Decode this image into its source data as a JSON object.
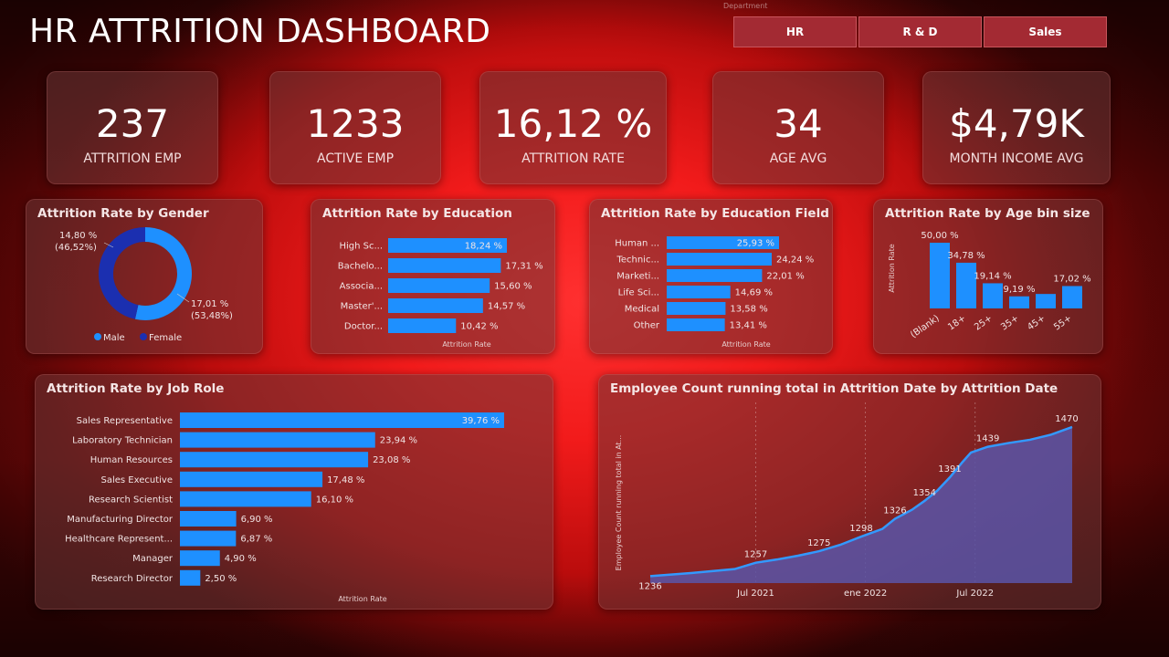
{
  "page": {
    "title": "HR ATTRITION DASHBOARD"
  },
  "slicer": {
    "label": "Department",
    "options": [
      "HR",
      "R & D",
      "Sales"
    ]
  },
  "colors": {
    "bar": "#1e90ff",
    "female": "#1b2fb0",
    "area_fill": "#5a55a8",
    "area_line": "#3399ff"
  },
  "kpis": [
    {
      "value": "237",
      "label": "ATTRITION EMP"
    },
    {
      "value": "1233",
      "label": "ACTIVE EMP"
    },
    {
      "value": "16,12 %",
      "label": "ATTRITION RATE"
    },
    {
      "value": "34",
      "label": "AGE AVG"
    },
    {
      "value": "$4,79K",
      "label": "MONTH INCOME AVG"
    }
  ],
  "chart_data": [
    {
      "id": "gender",
      "type": "pie",
      "title": "Attrition Rate by Gender",
      "categories": [
        "Male",
        "Female"
      ],
      "values": [
        17.01,
        14.8
      ],
      "shares": [
        53.48,
        46.52
      ],
      "data_labels": [
        "17,01 %",
        "14,80 %"
      ],
      "share_labels": [
        "(53,48%)",
        "(46,52%)"
      ],
      "legend": "bottom"
    },
    {
      "id": "education",
      "type": "bar",
      "orientation": "horizontal",
      "title": "Attrition Rate by Education",
      "categories": [
        "High Sc...",
        "Bachelo...",
        "Associa...",
        "Master'...",
        "Doctor..."
      ],
      "values": [
        18.24,
        17.31,
        15.6,
        14.57,
        10.42
      ],
      "data_labels": [
        "18,24 %",
        "17,31 %",
        "15,60 %",
        "14,57 %",
        "10,42 %"
      ],
      "xlabel": "Attrition Rate"
    },
    {
      "id": "education_field",
      "type": "bar",
      "orientation": "horizontal",
      "title": "Attrition Rate by Education Field",
      "categories": [
        "Human ...",
        "Technic...",
        "Marketi...",
        "Life Sci...",
        "Medical",
        "Other"
      ],
      "values": [
        25.93,
        24.24,
        22.01,
        14.69,
        13.58,
        13.41
      ],
      "data_labels": [
        "25,93 %",
        "24,24 %",
        "22,01 %",
        "14,69 %",
        "13,58 %",
        "13,41 %"
      ],
      "xlabel": "Attrition Rate"
    },
    {
      "id": "age_bin",
      "type": "bar",
      "orientation": "vertical",
      "title": "Attrition Rate by Age bin size",
      "categories": [
        "(Blank)",
        "18+",
        "25+",
        "35+",
        "45+",
        "55+"
      ],
      "values": [
        50.0,
        34.78,
        19.14,
        9.19,
        11.0,
        17.02
      ],
      "data_labels": [
        "50,00 %",
        "34,78 %",
        "19,14 %",
        "9,19 %",
        "",
        "17,02 %"
      ],
      "ylabel": "Attrition Rate"
    },
    {
      "id": "job_role",
      "type": "bar",
      "orientation": "horizontal",
      "title": "Attrition Rate by Job Role",
      "categories": [
        "Sales Representative",
        "Laboratory Technician",
        "Human Resources",
        "Sales Executive",
        "Research Scientist",
        "Manufacturing Director",
        "Healthcare Represent...",
        "Manager",
        "Research Director"
      ],
      "values": [
        39.76,
        23.94,
        23.08,
        17.48,
        16.1,
        6.9,
        6.87,
        4.9,
        2.5
      ],
      "data_labels": [
        "39,76 %",
        "23,94 %",
        "23,08 %",
        "17,48 %",
        "16,10 %",
        "6,90 %",
        "6,87 %",
        "4,90 %",
        "2,50 %"
      ],
      "xlabel": "Attrition Rate"
    },
    {
      "id": "running_total",
      "type": "area",
      "title": "Employee Count running total in Attrition Date by Attrition Date",
      "ylabel": "Employee Count running total in At...",
      "x_ticks": [
        "Jul 2021",
        "ene 2022",
        "Jul 2022"
      ],
      "x_tick_pos": [
        0.25,
        0.51,
        0.77
      ],
      "points": [
        [
          0,
          1236
        ],
        [
          0.1,
          1241
        ],
        [
          0.2,
          1247
        ],
        [
          0.25,
          1257
        ],
        [
          0.3,
          1262
        ],
        [
          0.35,
          1268
        ],
        [
          0.4,
          1275
        ],
        [
          0.45,
          1285
        ],
        [
          0.5,
          1298
        ],
        [
          0.55,
          1310
        ],
        [
          0.58,
          1326
        ],
        [
          0.62,
          1340
        ],
        [
          0.65,
          1354
        ],
        [
          0.68,
          1370
        ],
        [
          0.71,
          1391
        ],
        [
          0.74,
          1415
        ],
        [
          0.76,
          1430
        ],
        [
          0.8,
          1439
        ],
        [
          0.85,
          1445
        ],
        [
          0.9,
          1450
        ],
        [
          0.95,
          1458
        ],
        [
          1.0,
          1470
        ]
      ],
      "labels": [
        {
          "x": 0,
          "y": 1236,
          "text": "1236"
        },
        {
          "x": 0.25,
          "y": 1257,
          "text": "1257"
        },
        {
          "x": 0.4,
          "y": 1275,
          "text": "1275"
        },
        {
          "x": 0.5,
          "y": 1298,
          "text": "1298"
        },
        {
          "x": 0.58,
          "y": 1326,
          "text": "1326"
        },
        {
          "x": 0.65,
          "y": 1354,
          "text": "1354"
        },
        {
          "x": 0.71,
          "y": 1391,
          "text": "1391"
        },
        {
          "x": 0.8,
          "y": 1439,
          "text": "1439"
        },
        {
          "x": 1.0,
          "y": 1470,
          "text": "1470"
        }
      ],
      "ylim": [
        1225,
        1480
      ]
    }
  ]
}
